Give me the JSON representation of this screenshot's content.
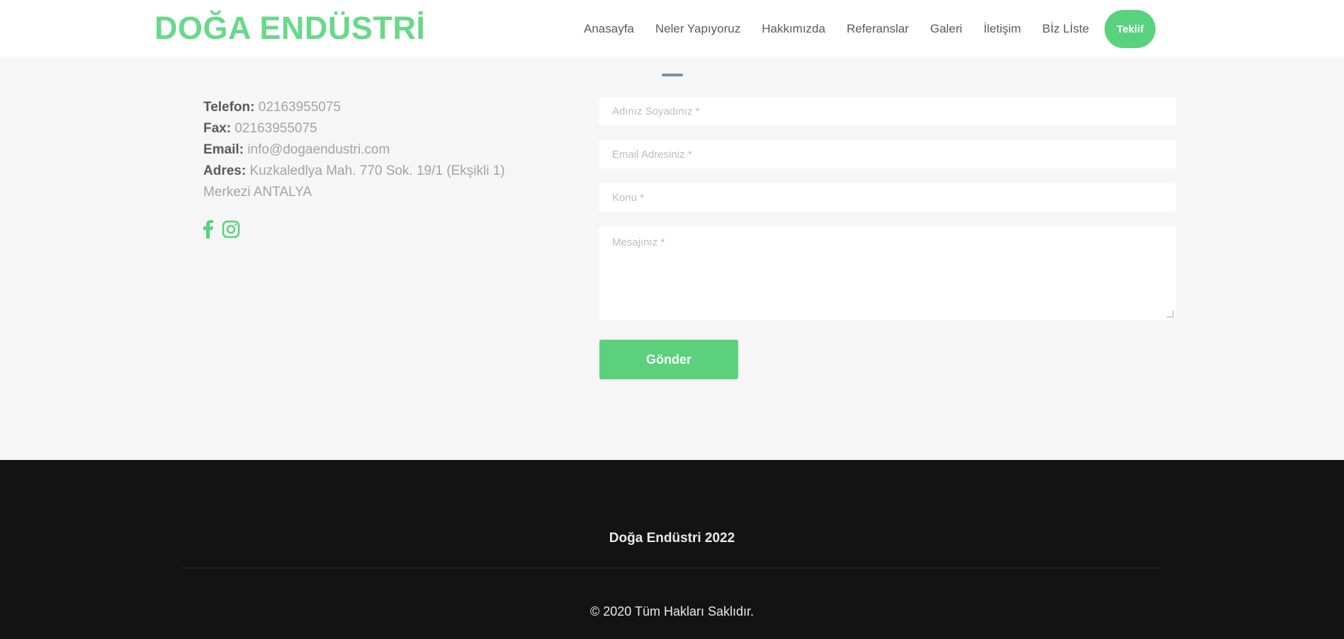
{
  "header": {
    "logo": "DOĞA ENDÜSTRİ",
    "nav": [
      "Anasayfa",
      "Neler Yapıyoruz",
      "Hakkımızda",
      "Referanslar",
      "Galeri",
      "İletişim",
      "Bİz Lİste"
    ],
    "cta": "Teklif"
  },
  "contact": {
    "phone_label": "Telefon:",
    "phone": "02163955075",
    "fax_label": "Fax:",
    "fax": "02163955075",
    "email_label": "Email:",
    "email": "info@dogaendustri.com",
    "address_label": "Adres:",
    "address": "Kuzkaledlya Mah. 770 Sok. 19/1 (Ekşikli 1) Merkezi ANTALYA"
  },
  "socials": [
    "facebook-icon",
    "instagram-icon"
  ],
  "form": {
    "name_placeholder": "Adınız Soyadınız *",
    "email_placeholder": "Email Adresiniz *",
    "subject_placeholder": "Konu *",
    "message_placeholder": "Mesajınız *",
    "submit_label": "Gönder"
  },
  "footer": {
    "brand": "Doğa Endüstri 2022",
    "copyright": "© 2020 Tüm Hakları Saklıdır."
  },
  "colors": {
    "accent": "#58d27d",
    "footer_bg": "#131313",
    "page_bg": "#f6f6f6"
  }
}
